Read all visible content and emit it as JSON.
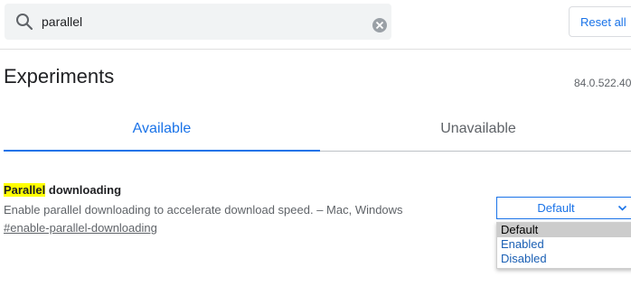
{
  "search": {
    "value": "parallel",
    "icon": "search-icon",
    "clear_icon": "clear-icon"
  },
  "toolbar": {
    "reset_label": "Reset all"
  },
  "page": {
    "title": "Experiments",
    "version": "84.0.522.40"
  },
  "tabs": [
    {
      "label": "Available",
      "active": true
    },
    {
      "label": "Unavailable",
      "active": false
    }
  ],
  "experiment": {
    "name_highlight": "Parallel",
    "name_rest": " downloading",
    "description": "Enable parallel downloading to accelerate download speed. – Mac, Windows",
    "link": "#enable-parallel-downloading",
    "selected_value": "Default",
    "options": [
      "Default",
      "Enabled",
      "Disabled"
    ]
  },
  "colors": {
    "accent": "#1a73e8",
    "highlight": "#ffff00"
  }
}
